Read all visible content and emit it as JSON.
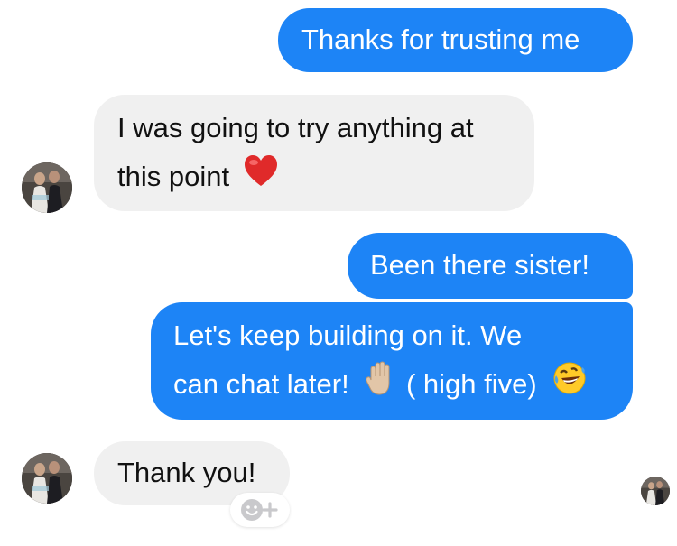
{
  "messages": [
    {
      "id": "m1",
      "direction": "outgoing",
      "lines": [
        "Thanks for trusting me"
      ]
    },
    {
      "id": "m2",
      "direction": "incoming",
      "lines": [
        "I was going to try anything at",
        "this point"
      ],
      "trailing_emoji": "red-heart"
    },
    {
      "id": "m3",
      "direction": "outgoing",
      "lines": [
        "Been there sister!"
      ]
    },
    {
      "id": "m4",
      "direction": "outgoing",
      "lines": [
        "Let's keep building on it. We",
        "can chat later!",
        "( high five)"
      ],
      "inline_emoji": [
        "raised-hand",
        "rolling-laughing-face"
      ]
    },
    {
      "id": "m5",
      "direction": "incoming",
      "lines": [
        "Thank you!"
      ]
    }
  ],
  "icons": {
    "heart": "red-heart-icon",
    "hand": "raised-hand-icon",
    "laugh": "rolling-on-floor-laughing-icon",
    "react": "add-reaction-icon"
  },
  "colors": {
    "outgoing_bubble": "#1d84f6",
    "incoming_bubble": "#f0f0f0",
    "outgoing_text": "#ffffff",
    "incoming_text": "#111111"
  }
}
